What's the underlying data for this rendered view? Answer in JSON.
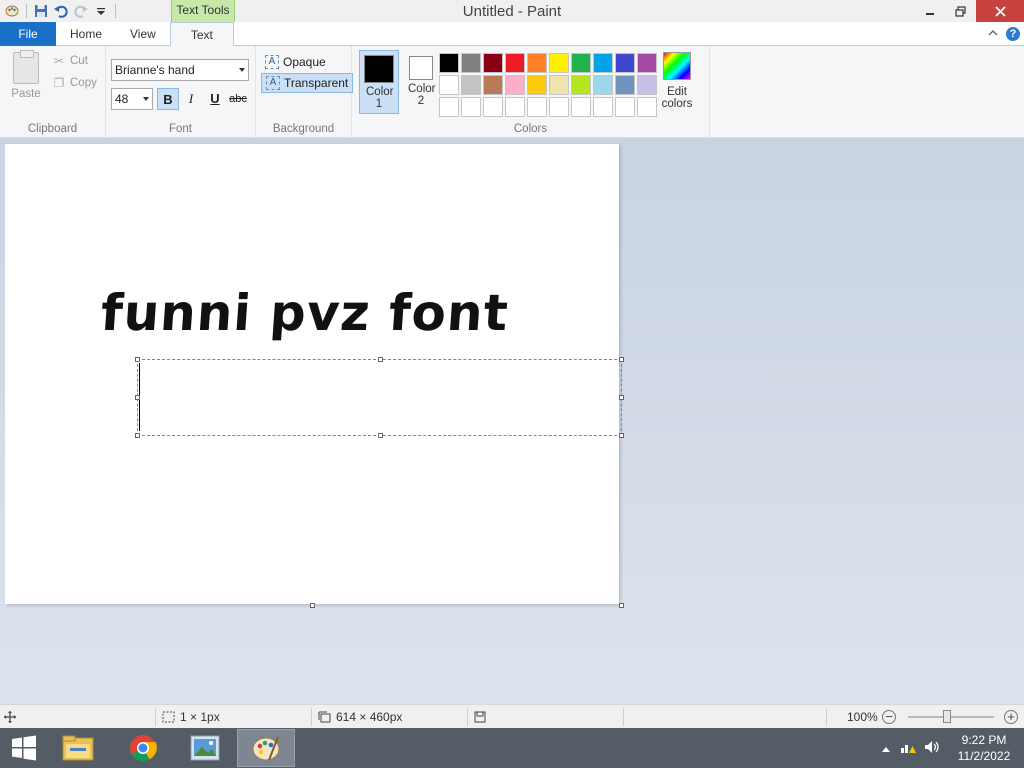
{
  "window": {
    "title": "Untitled - Paint",
    "context_tab": "Text Tools"
  },
  "tabs": {
    "file": "File",
    "home": "Home",
    "view": "View",
    "text": "Text"
  },
  "ribbon": {
    "clipboard": {
      "label": "Clipboard",
      "paste": "Paste",
      "cut": "Cut",
      "copy": "Copy"
    },
    "font": {
      "label": "Font",
      "family": "Brianne's hand",
      "size": "48",
      "bold": "B",
      "italic": "I",
      "underline": "U",
      "strike": "abc"
    },
    "background": {
      "label": "Background",
      "opaque": "Opaque",
      "transparent": "Transparent"
    },
    "colors": {
      "label": "Colors",
      "color1_label": "Color 1",
      "color2_label": "Color 2",
      "color1": "#000000",
      "color2": "#ffffff",
      "edit_colors": "Edit colors",
      "palette": [
        "#000000",
        "#7f7f7f",
        "#880015",
        "#ed1c24",
        "#ff7f27",
        "#fff200",
        "#22b14c",
        "#00a2e8",
        "#3f48cc",
        "#a349a4",
        "#ffffff",
        "#c3c3c3",
        "#b97a57",
        "#ffaec9",
        "#ffc90e",
        "#efe4b0",
        "#b5e61d",
        "#99d9ea",
        "#7092be",
        "#c8bfe7",
        "#ffffff",
        "#ffffff",
        "#ffffff",
        "#ffffff",
        "#ffffff",
        "#ffffff",
        "#ffffff",
        "#ffffff",
        "#ffffff",
        "#ffffff"
      ]
    }
  },
  "canvas": {
    "text": "funni pvz font"
  },
  "status": {
    "selection": "1 × 1px",
    "image_size": "614 × 460px",
    "zoom": "100%",
    "zoom_fraction": 0.45
  },
  "taskbar": {
    "time": "9:22 PM",
    "date": "11/2/2022"
  }
}
